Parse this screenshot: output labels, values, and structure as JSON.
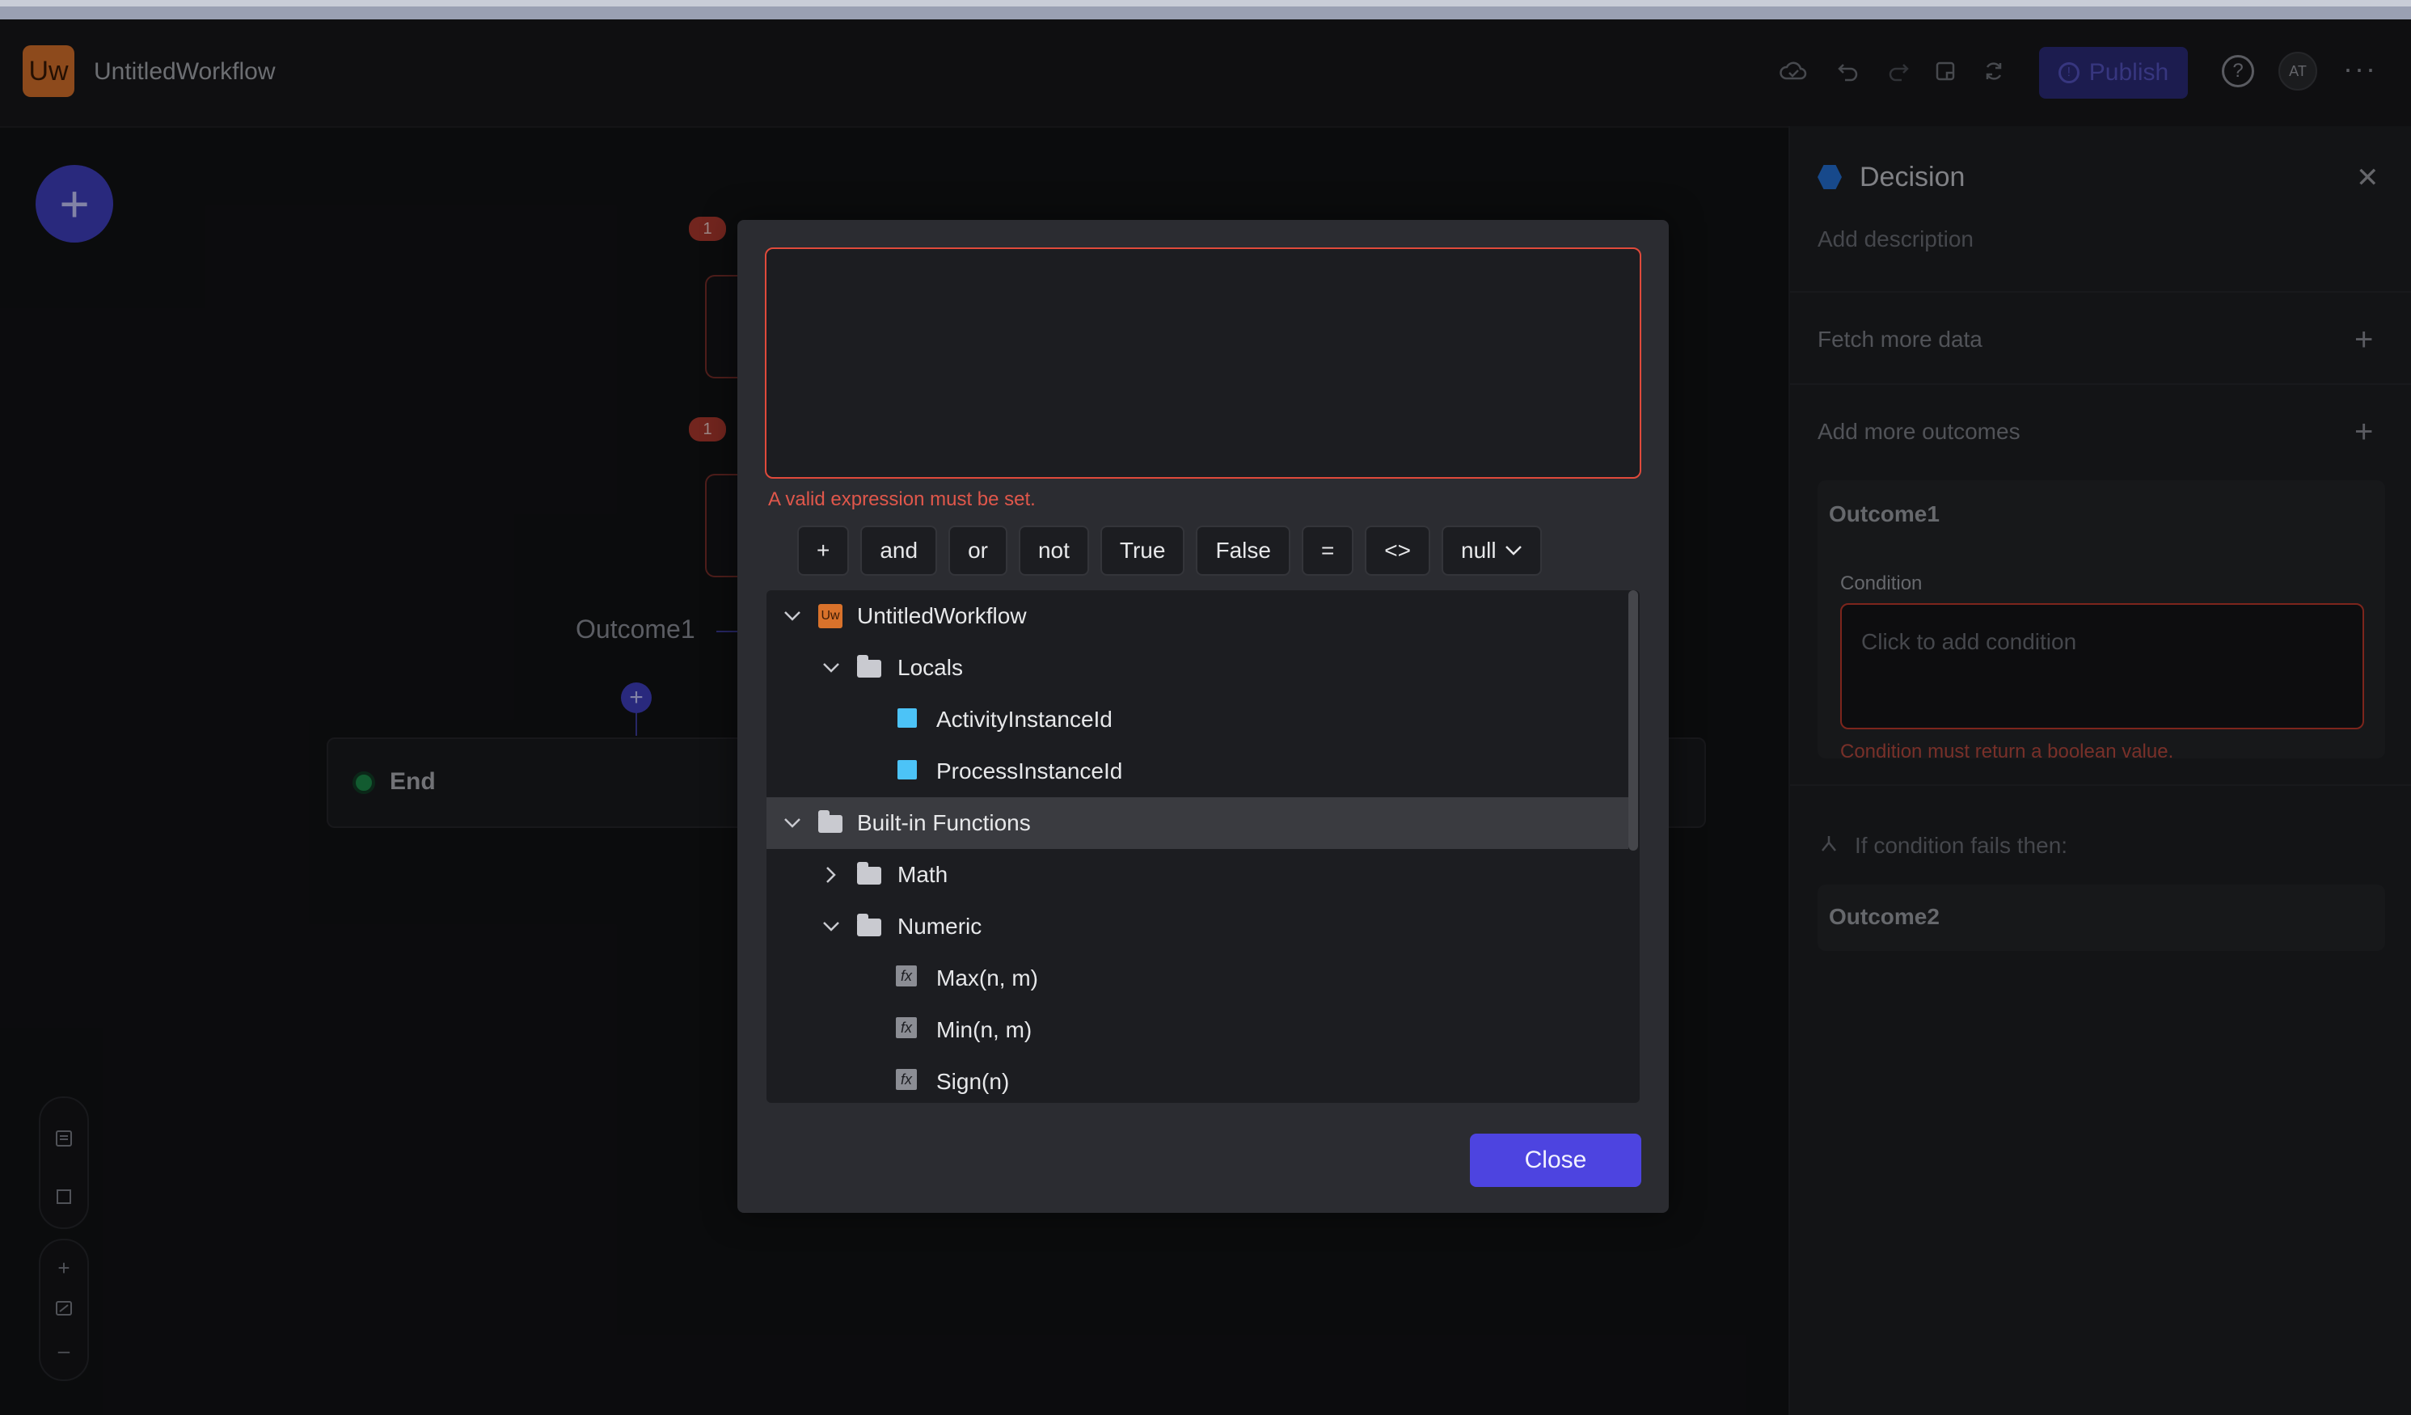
{
  "app": {
    "badge": "Uw",
    "title": "UntitledWorkflow",
    "publish_label": "Publish",
    "avatar": "AT",
    "more": "···",
    "help": "?"
  },
  "canvas": {
    "add_icon": "+",
    "node_badges": [
      "1",
      "1"
    ],
    "outcome_label": "Outcome1",
    "end_label": "End"
  },
  "right_panel": {
    "title": "Decision",
    "close": "✕",
    "description_placeholder": "Add description",
    "fetch_more": "Fetch more data",
    "add_outcomes": "Add more outcomes",
    "outcome1": "Outcome1",
    "condition_label": "Condition",
    "condition_placeholder": "Click to add condition",
    "condition_error": "Condition must return a boolean value.",
    "fail_label": "If condition fails then:",
    "outcome2": "Outcome2"
  },
  "modal": {
    "error": "A valid expression must be set.",
    "operators": [
      "+",
      "and",
      "or",
      "not",
      "True",
      "False",
      "=",
      "<>",
      "null"
    ],
    "tree": [
      {
        "label": "UntitledWorkflow",
        "icon": "uw"
      },
      {
        "label": "Locals",
        "icon": "folder"
      },
      {
        "label": "ActivityInstanceId",
        "icon": "variable"
      },
      {
        "label": "ProcessInstanceId",
        "icon": "variable"
      },
      {
        "label": "Built-in Functions",
        "icon": "folder"
      },
      {
        "label": "Math",
        "icon": "folder"
      },
      {
        "label": "Numeric",
        "icon": "folder"
      },
      {
        "label": "Max(n, m)",
        "icon": "function"
      },
      {
        "label": "Min(n, m)",
        "icon": "function"
      },
      {
        "label": "Sign(n)",
        "icon": "function"
      }
    ],
    "close_label": "Close"
  },
  "colors": {
    "accent": "#4d44e0",
    "error": "#e04a3b",
    "variable": "#4cc3f7",
    "brand": "#d9722b"
  }
}
